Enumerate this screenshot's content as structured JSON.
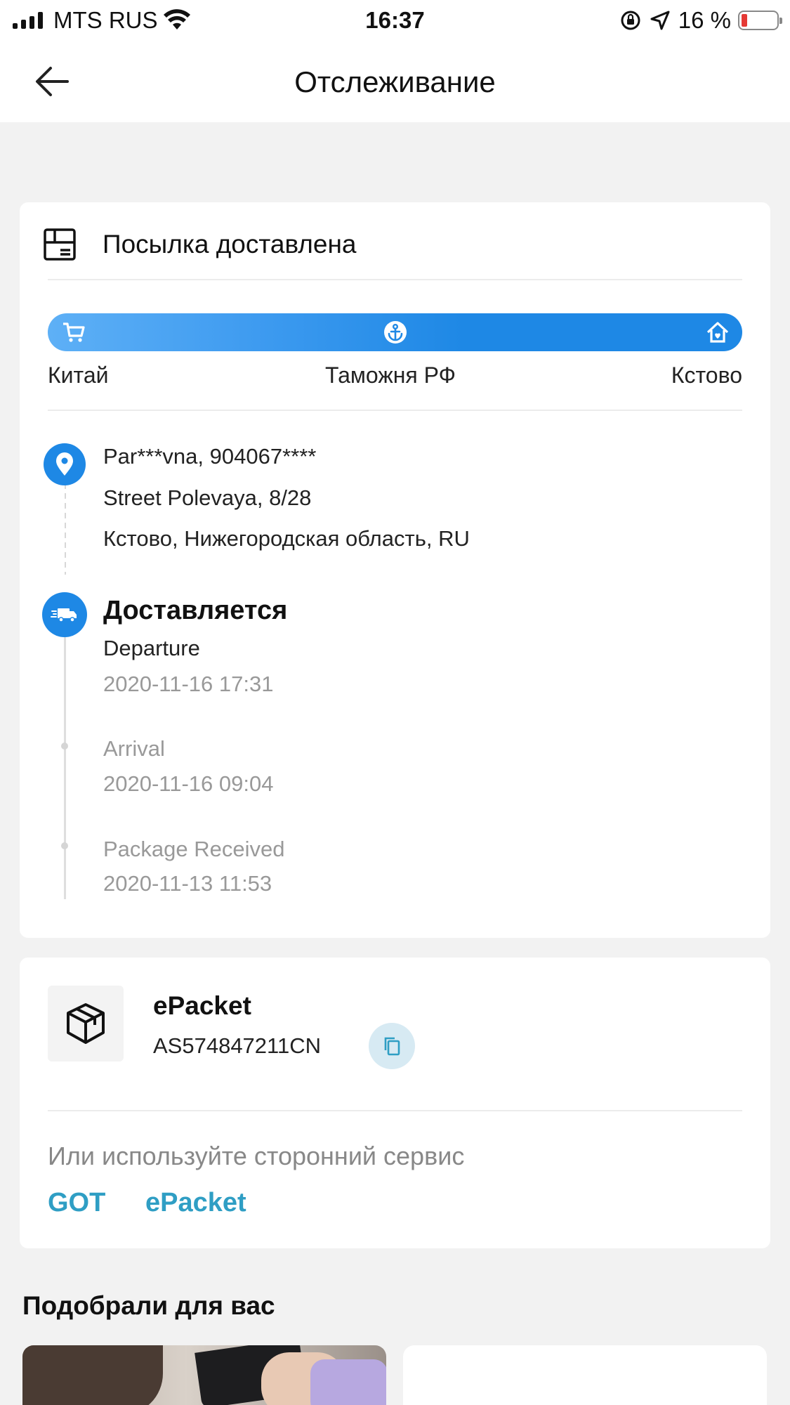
{
  "status_bar": {
    "carrier": "MTS RUS",
    "time": "16:37",
    "battery_percent": "16 %",
    "battery_level": 0.16
  },
  "nav": {
    "title": "Отслеживание"
  },
  "shipment": {
    "status": "Посылка доставлена",
    "route": {
      "origin": "Китай",
      "customs": "Таможня РФ",
      "destination": "Кстово",
      "icons": [
        "cart-icon",
        "anchor-icon",
        "home-icon"
      ]
    },
    "address": {
      "recipient": "Par***vna, 904067****",
      "street": "Street Polevaya, 8/28",
      "city": "Кстово, Нижегородская область, RU"
    },
    "current_stage": "Доставляется",
    "events": [
      {
        "title": "Departure",
        "time": "2020-11-16 17:31"
      },
      {
        "title": "Arrival",
        "time": "2020-11-16 09:04"
      },
      {
        "title": "Package Received",
        "time": "2020-11-13 11:53"
      }
    ]
  },
  "package": {
    "carrier": "ePacket",
    "tracking_number": "AS574847211CN",
    "third_party_label": "Или используйте сторонний сервис",
    "third_party_links": [
      "GOT",
      "ePacket"
    ]
  },
  "recommendations": {
    "title": "Подобрали для вас"
  },
  "colors": {
    "accent": "#1e88e5",
    "link": "#2f9ec4",
    "battery_low": "#e53935"
  }
}
